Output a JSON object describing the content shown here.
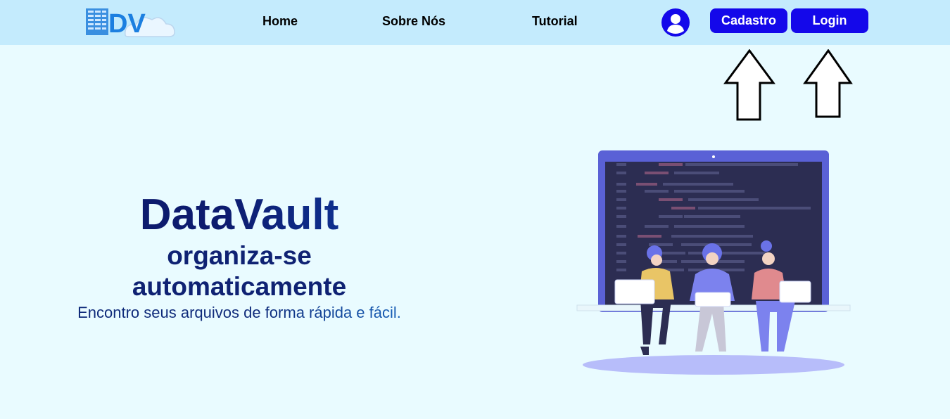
{
  "navbar": {
    "logo_text": "DV",
    "links": [
      "Home",
      "Sobre Nós",
      "Tutorial"
    ],
    "profile_icon": "user-circle-icon",
    "cadastro_label": "Cadastro",
    "login_label": "Login"
  },
  "hero": {
    "title": "DataVault",
    "subtitle_line1": "organiza-se",
    "subtitle_line2": "automaticamente",
    "description": "Encontro seus arquivos de forma rápida e fácil."
  },
  "colors": {
    "navbar_bg": "#c4ebfd",
    "page_bg": "#e9fbff",
    "button_blue": "#1408ea",
    "title_navy": "#0d1b6e"
  }
}
